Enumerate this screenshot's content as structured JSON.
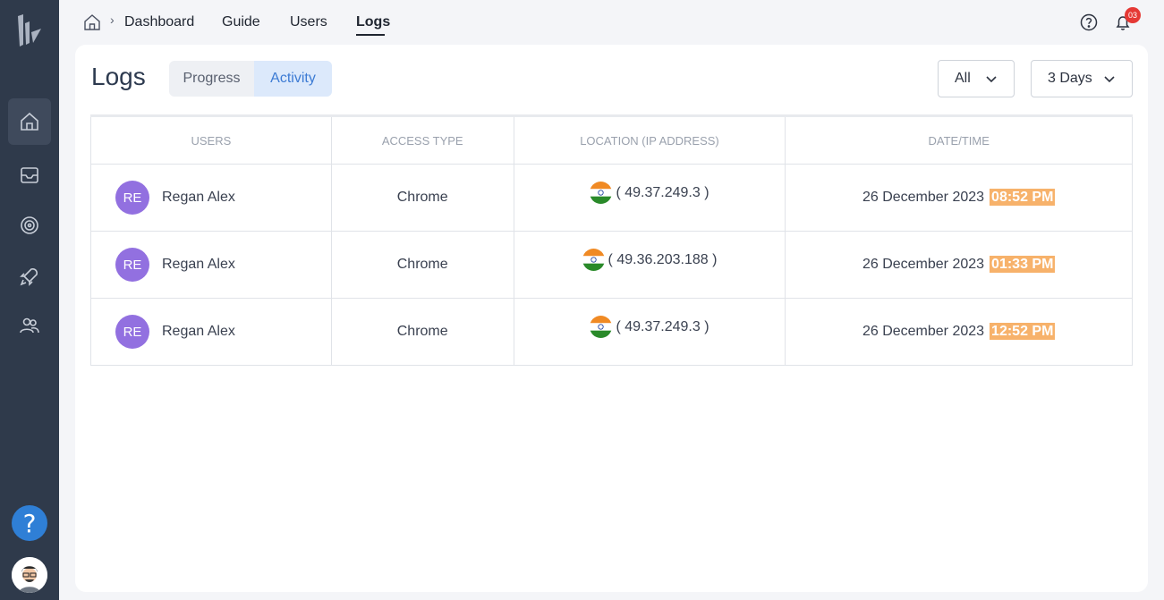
{
  "breadcrumb": {
    "items": [
      {
        "label": "Dashboard"
      },
      {
        "label": "Guide"
      },
      {
        "label": "Users"
      },
      {
        "label": "Logs"
      }
    ]
  },
  "notifications": {
    "count": "03"
  },
  "page": {
    "title": "Logs",
    "tabs": [
      {
        "label": "Progress",
        "selected": false
      },
      {
        "label": "Activity",
        "selected": true
      }
    ],
    "filter_type": {
      "value": "All"
    },
    "filter_range": {
      "value": "3 Days"
    }
  },
  "table": {
    "headers": [
      "USERS",
      "ACCESS TYPE",
      "LOCATION (IP ADDRESS)",
      "DATE/TIME"
    ],
    "rows": [
      {
        "initials": "RE",
        "name": "Regan Alex",
        "access": "Chrome",
        "ip": "( 49.37.249.3 )",
        "date": "26 December 2023",
        "time": "08:52 PM"
      },
      {
        "initials": "RE",
        "name": "Regan Alex",
        "access": "Chrome",
        "ip": "( 49.36.203.188 )",
        "date": "26 December 2023",
        "time": "01:33 PM"
      },
      {
        "initials": "RE",
        "name": "Regan Alex",
        "access": "Chrome",
        "ip": "( 49.37.249.3 )",
        "date": "26 December 2023",
        "time": "12:52 PM"
      }
    ]
  },
  "colors": {
    "sidebar": "#2f3a4b",
    "accent": "#3c7bd4",
    "avatar": "#9270e0",
    "time_highlight": "#f7b26b",
    "badge": "#e53935"
  },
  "icons": {
    "sidebar": [
      "home-icon",
      "inbox-icon",
      "target-icon",
      "rocket-icon",
      "users-icon"
    ],
    "flag": "india-flag-icon"
  }
}
